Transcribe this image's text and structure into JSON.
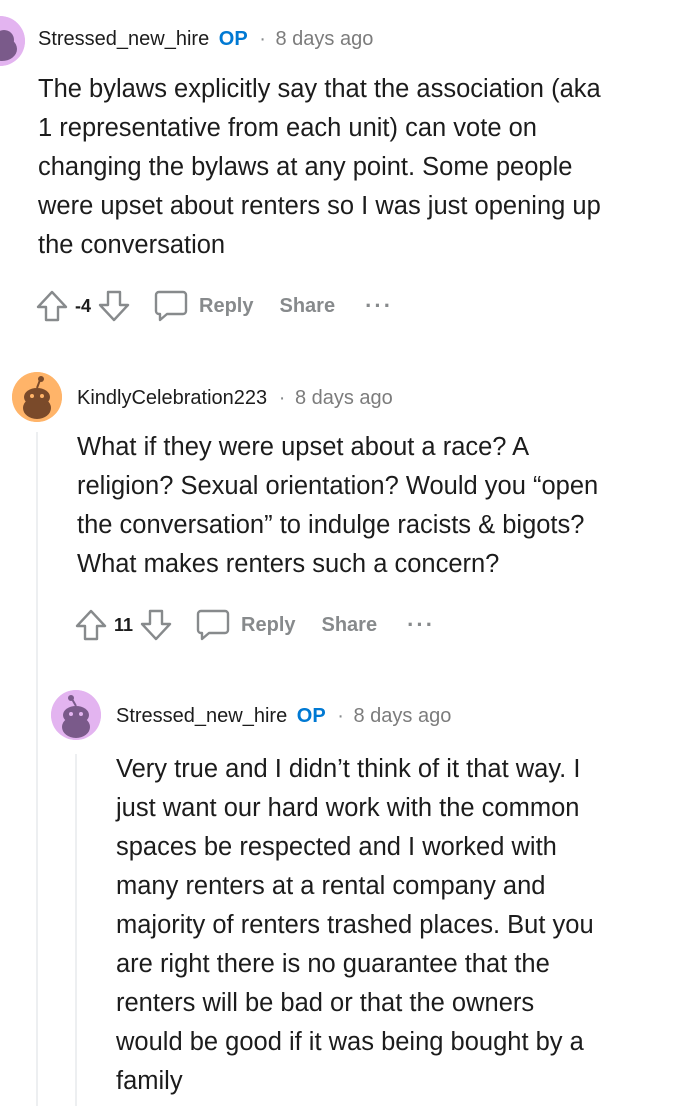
{
  "comments": [
    {
      "author": "Stressed_new_hire",
      "op_badge": "OP",
      "separator": "·",
      "time": "8 days ago",
      "lines": [
        "The bylaws explicitly say that the association (aka",
        "1 representative from each unit) can vote on",
        "changing the bylaws at any point. Some people",
        "were upset about renters so I was just opening up",
        "the conversation"
      ],
      "score": "-4",
      "reply_label": "Reply",
      "share_label": "Share",
      "more_label": "···"
    },
    {
      "author": "KindlyCelebration223",
      "separator": "·",
      "time": "8 days ago",
      "lines": [
        "What if they were upset about a race? A",
        "religion? Sexual orientation? Would you “open",
        "the conversation” to indulge racists & bigots?",
        "What makes renters such a concern?"
      ],
      "score": "11",
      "reply_label": "Reply",
      "share_label": "Share",
      "more_label": "···"
    },
    {
      "author": "Stressed_new_hire",
      "op_badge": "OP",
      "separator": "·",
      "time": "8 days ago",
      "lines": [
        "Very true and I didn’t think of it that way. I",
        "just want our hard work with the common",
        "spaces be respected and I worked with",
        "many renters at a rental company and",
        "majority of renters trashed places. But you",
        "are right there is no guarantee that the",
        "renters will be bad or that the owners",
        "would be good if it was being bought by a",
        "family"
      ]
    }
  ],
  "colors": {
    "op_blue": "#0079d3",
    "meta_gray": "#7c7c7c",
    "action_gray": "#878a8c",
    "avatar_purple": "#e3b4f0",
    "avatar_orange": "#ffb469",
    "thread_line": "#edeff1"
  },
  "icons": [
    "snoo-avatar-icon",
    "upvote-icon",
    "downvote-icon",
    "comment-bubble-icon",
    "more-dots-icon"
  ]
}
